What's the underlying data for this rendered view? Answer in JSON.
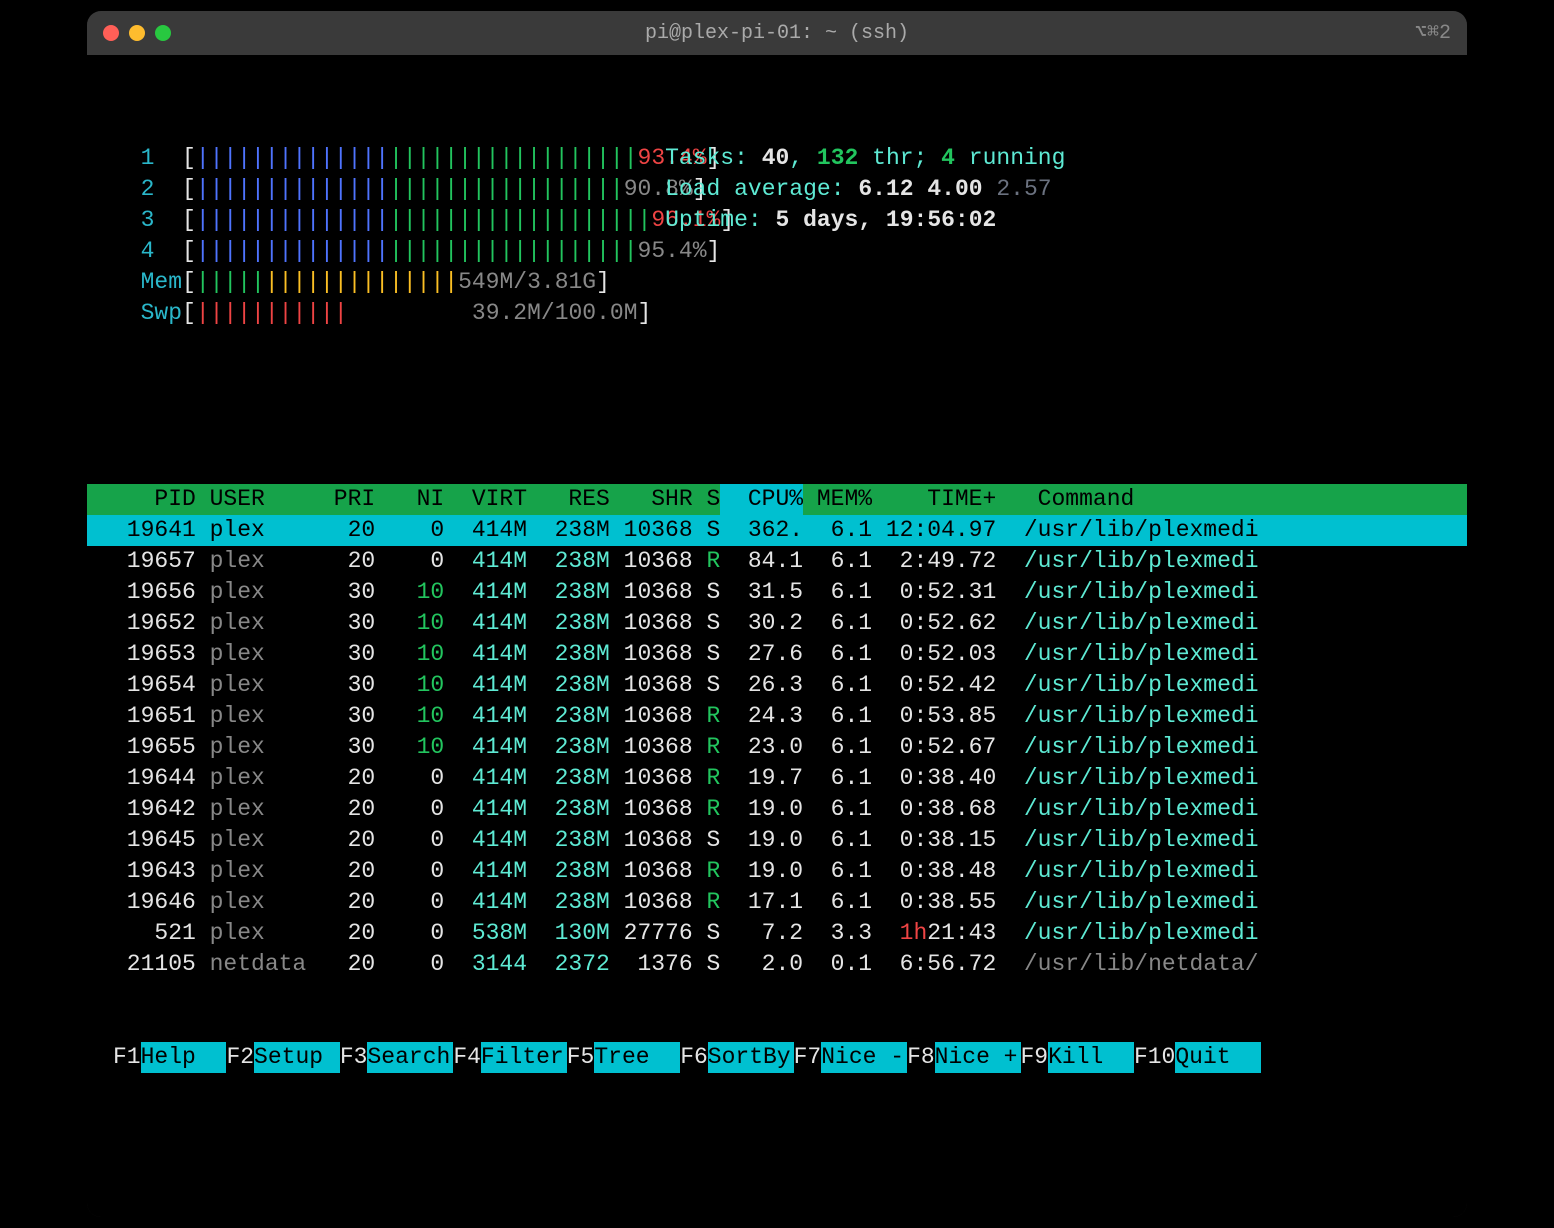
{
  "window": {
    "title": "pi@plex-pi-01: ~ (ssh)",
    "shortcut": "⌥⌘2"
  },
  "cpus": [
    {
      "n": "1",
      "blue": 14,
      "green": 18,
      "pct": "93.4",
      "pctColor": "red"
    },
    {
      "n": "2",
      "blue": 14,
      "green": 17,
      "pct": "90.8",
      "pctColor": "gray"
    },
    {
      "n": "3",
      "blue": 14,
      "green": 19,
      "pct": "96.1",
      "pctColor": "red"
    },
    {
      "n": "4",
      "blue": 14,
      "green": 18,
      "pct": "95.4",
      "pctColor": "gray"
    }
  ],
  "mem": {
    "label": "Mem",
    "green": 5,
    "yellow": 14,
    "val": "549M/3.81G"
  },
  "swp": {
    "label": "Swp",
    "red": 11,
    "val": "39.2M/100.0M"
  },
  "tasks": {
    "label": "Tasks: ",
    "procs": "40",
    "sep1": ", ",
    "thr": "132",
    "thr_label": " thr; ",
    "running": "4",
    "running_label": " running"
  },
  "load": {
    "label": "Load average: ",
    "l1": "6.12",
    "l2": "4.00",
    "l3": "2.57"
  },
  "uptime": {
    "label": "Uptime: ",
    "val": "5 days, 19:56:02"
  },
  "header": {
    "pid": "PID",
    "user": "USER",
    "pri": "PRI",
    "ni": "NI",
    "virt": "VIRT",
    "res": "RES",
    "shr": "SHR",
    "s": "S",
    "cpu": "CPU%",
    "mem": "MEM%",
    "time": "TIME+",
    "cmd": "Command"
  },
  "procs": [
    {
      "pid": "19641",
      "user": "plex",
      "pri": "20",
      "ni": "0",
      "virt": "414M",
      "res": "238M",
      "shr": "10368",
      "s": "S",
      "cpu": "362.",
      "mem": "6.1",
      "time": "12:04.97",
      "time_red": "",
      "cmd": "/usr/lib/plexmedi",
      "sel": true
    },
    {
      "pid": "19657",
      "user": "plex",
      "pri": "20",
      "ni": "0",
      "virt": "414M",
      "res": "238M",
      "shr": "10368",
      "s": "R",
      "cpu": "84.1",
      "mem": "6.1",
      "time": "2:49.72",
      "cmd": "/usr/lib/plexmedi"
    },
    {
      "pid": "19656",
      "user": "plex",
      "pri": "30",
      "ni": "10",
      "virt": "414M",
      "res": "238M",
      "shr": "10368",
      "s": "S",
      "cpu": "31.5",
      "mem": "6.1",
      "time": "0:52.31",
      "cmd": "/usr/lib/plexmedi"
    },
    {
      "pid": "19652",
      "user": "plex",
      "pri": "30",
      "ni": "10",
      "virt": "414M",
      "res": "238M",
      "shr": "10368",
      "s": "S",
      "cpu": "30.2",
      "mem": "6.1",
      "time": "0:52.62",
      "cmd": "/usr/lib/plexmedi"
    },
    {
      "pid": "19653",
      "user": "plex",
      "pri": "30",
      "ni": "10",
      "virt": "414M",
      "res": "238M",
      "shr": "10368",
      "s": "S",
      "cpu": "27.6",
      "mem": "6.1",
      "time": "0:52.03",
      "cmd": "/usr/lib/plexmedi"
    },
    {
      "pid": "19654",
      "user": "plex",
      "pri": "30",
      "ni": "10",
      "virt": "414M",
      "res": "238M",
      "shr": "10368",
      "s": "S",
      "cpu": "26.3",
      "mem": "6.1",
      "time": "0:52.42",
      "cmd": "/usr/lib/plexmedi"
    },
    {
      "pid": "19651",
      "user": "plex",
      "pri": "30",
      "ni": "10",
      "virt": "414M",
      "res": "238M",
      "shr": "10368",
      "s": "R",
      "cpu": "24.3",
      "mem": "6.1",
      "time": "0:53.85",
      "cmd": "/usr/lib/plexmedi"
    },
    {
      "pid": "19655",
      "user": "plex",
      "pri": "30",
      "ni": "10",
      "virt": "414M",
      "res": "238M",
      "shr": "10368",
      "s": "R",
      "cpu": "23.0",
      "mem": "6.1",
      "time": "0:52.67",
      "cmd": "/usr/lib/plexmedi"
    },
    {
      "pid": "19644",
      "user": "plex",
      "pri": "20",
      "ni": "0",
      "virt": "414M",
      "res": "238M",
      "shr": "10368",
      "s": "R",
      "cpu": "19.7",
      "mem": "6.1",
      "time": "0:38.40",
      "cmd": "/usr/lib/plexmedi"
    },
    {
      "pid": "19642",
      "user": "plex",
      "pri": "20",
      "ni": "0",
      "virt": "414M",
      "res": "238M",
      "shr": "10368",
      "s": "R",
      "cpu": "19.0",
      "mem": "6.1",
      "time": "0:38.68",
      "cmd": "/usr/lib/plexmedi"
    },
    {
      "pid": "19645",
      "user": "plex",
      "pri": "20",
      "ni": "0",
      "virt": "414M",
      "res": "238M",
      "shr": "10368",
      "s": "S",
      "cpu": "19.0",
      "mem": "6.1",
      "time": "0:38.15",
      "cmd": "/usr/lib/plexmedi"
    },
    {
      "pid": "19643",
      "user": "plex",
      "pri": "20",
      "ni": "0",
      "virt": "414M",
      "res": "238M",
      "shr": "10368",
      "s": "R",
      "cpu": "19.0",
      "mem": "6.1",
      "time": "0:38.48",
      "cmd": "/usr/lib/plexmedi"
    },
    {
      "pid": "19646",
      "user": "plex",
      "pri": "20",
      "ni": "0",
      "virt": "414M",
      "res": "238M",
      "shr": "10368",
      "s": "R",
      "cpu": "17.1",
      "mem": "6.1",
      "time": "0:38.55",
      "cmd": "/usr/lib/plexmedi"
    },
    {
      "pid": "521",
      "user": "plex",
      "pri": "20",
      "ni": "0",
      "virt": "538M",
      "res": "130M",
      "shr": "27776",
      "s": "S",
      "cpu": "7.2",
      "mem": "3.3",
      "time": "21:43",
      "time_red": "1h",
      "cmd": "/usr/lib/plexmedi"
    },
    {
      "pid": "21105",
      "user": "netdata",
      "pri": "20",
      "ni": "0",
      "virt": "3144",
      "res": "2372",
      "shr": "1376",
      "s": "S",
      "cpu": "2.0",
      "mem": "0.1",
      "time": "6:56.72",
      "cmd": "/usr/lib/netdata/"
    }
  ],
  "footer": [
    {
      "key": "F1",
      "label": "Help  "
    },
    {
      "key": "F2",
      "label": "Setup "
    },
    {
      "key": "F3",
      "label": "Search"
    },
    {
      "key": "F4",
      "label": "Filter"
    },
    {
      "key": "F5",
      "label": "Tree  "
    },
    {
      "key": "F6",
      "label": "SortBy"
    },
    {
      "key": "F7",
      "label": "Nice -"
    },
    {
      "key": "F8",
      "label": "Nice +"
    },
    {
      "key": "F9",
      "label": "Kill  "
    },
    {
      "key": "F10",
      "label": "Quit  "
    }
  ]
}
